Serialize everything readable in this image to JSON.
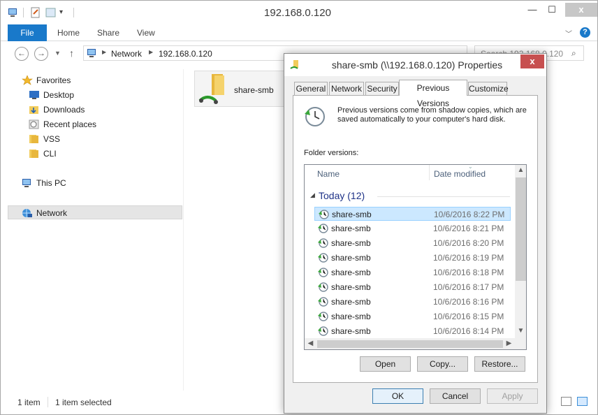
{
  "window": {
    "title": "192.168.0.120",
    "close": "x",
    "minimize": "—",
    "maximize": "☐"
  },
  "ribbon": {
    "tabs": [
      "File",
      "Home",
      "Share",
      "View"
    ]
  },
  "address": {
    "crumbs": [
      "Network",
      "192.168.0.120"
    ],
    "search_placeholder": "Search 192.168.0.120"
  },
  "nav": {
    "favorites": "Favorites",
    "items": [
      "Desktop",
      "Downloads",
      "Recent places",
      "VSS",
      "CLI"
    ],
    "this_pc": "This PC",
    "network": "Network"
  },
  "content": {
    "item_label": "share-smb"
  },
  "status": {
    "count": "1 item",
    "selected": "1 item selected"
  },
  "dialog": {
    "title": "share-smb (\\\\192.168.0.120) Properties",
    "close": "x",
    "tabs": [
      "General",
      "Network",
      "Security",
      "Previous Versions",
      "Customize"
    ],
    "description": "Previous versions come from shadow copies, which are saved automatically to your computer's hard disk.",
    "folder_versions_label": "Folder versions:",
    "columns": {
      "name": "Name",
      "date": "Date modified"
    },
    "group": "Today (12)",
    "versions": [
      {
        "name": "share-smb",
        "date": "10/6/2016 8:22 PM"
      },
      {
        "name": "share-smb",
        "date": "10/6/2016 8:21 PM"
      },
      {
        "name": "share-smb",
        "date": "10/6/2016 8:20 PM"
      },
      {
        "name": "share-smb",
        "date": "10/6/2016 8:19 PM"
      },
      {
        "name": "share-smb",
        "date": "10/6/2016 8:18 PM"
      },
      {
        "name": "share-smb",
        "date": "10/6/2016 8:17 PM"
      },
      {
        "name": "share-smb",
        "date": "10/6/2016 8:16 PM"
      },
      {
        "name": "share-smb",
        "date": "10/6/2016 8:15 PM"
      },
      {
        "name": "share-smb",
        "date": "10/6/2016 8:14 PM"
      }
    ],
    "buttons": {
      "open": "Open",
      "copy": "Copy...",
      "restore": "Restore...",
      "ok": "OK",
      "cancel": "Cancel",
      "apply": "Apply"
    }
  },
  "colors": {
    "accent": "#1979ca",
    "selection": "#cce8ff",
    "dialog_close": "#c75050",
    "group_header": "#1e3287"
  }
}
